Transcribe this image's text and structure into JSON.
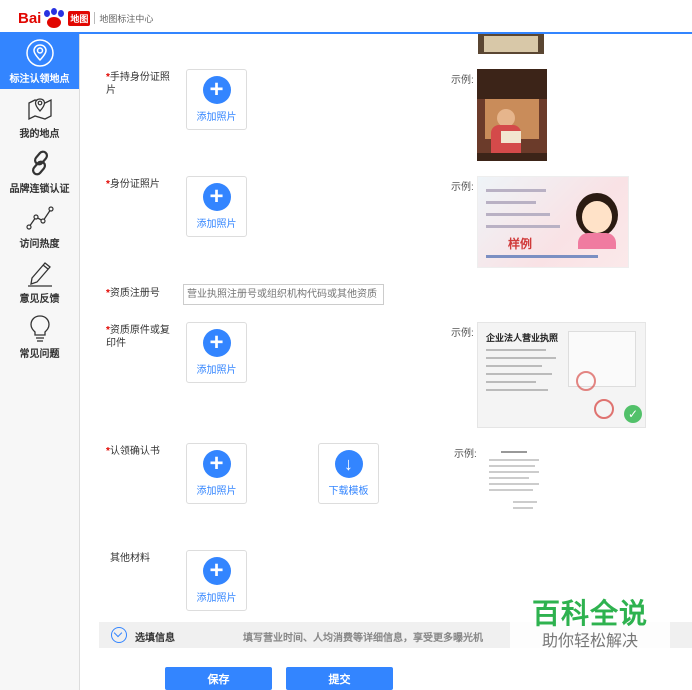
{
  "header": {
    "logo_left": "Bai",
    "logo_badge": "地图",
    "subtitle": "地图标注中心"
  },
  "sidebar": {
    "items": [
      {
        "label": "标注认领地点",
        "icon": "location-pin-icon",
        "active": true
      },
      {
        "label": "我的地点",
        "icon": "map-icon",
        "active": false
      },
      {
        "label": "品牌连锁认证",
        "icon": "chain-link-icon",
        "active": false
      },
      {
        "label": "访问热度",
        "icon": "trend-line-icon",
        "active": false
      },
      {
        "label": "意见反馈",
        "icon": "pencil-icon",
        "active": false
      },
      {
        "label": "常见问题",
        "icon": "lightbulb-icon",
        "active": false
      }
    ]
  },
  "form": {
    "required_mark": "*",
    "id_hand_label": "手持身份证照片",
    "id_card_label": "身份证照片",
    "reg_number_label": "资质注册号",
    "reg_number_placeholder": "营业执照注册号或组织机构代码或其他资质",
    "license_label": "资质原件或复印件",
    "confirm_label": "认领确认书",
    "other_label": "其他材料",
    "upload_text": "添加照片",
    "download_text": "下载模板",
    "example_label": "示例:"
  },
  "examples": {
    "id_card_text": "样例",
    "license_title": "企业法人营业执照"
  },
  "optional": {
    "title": "选填信息",
    "description": "填写营业时间、人均消费等详细信息，享受更多曝光机"
  },
  "actions": {
    "save": "保存",
    "submit": "提交"
  },
  "watermark": {
    "main": "百科全说",
    "sub": "助你轻松解决"
  },
  "colors": {
    "accent": "#3385ff",
    "required": "#e10601",
    "watermark": "#2eb24f"
  }
}
